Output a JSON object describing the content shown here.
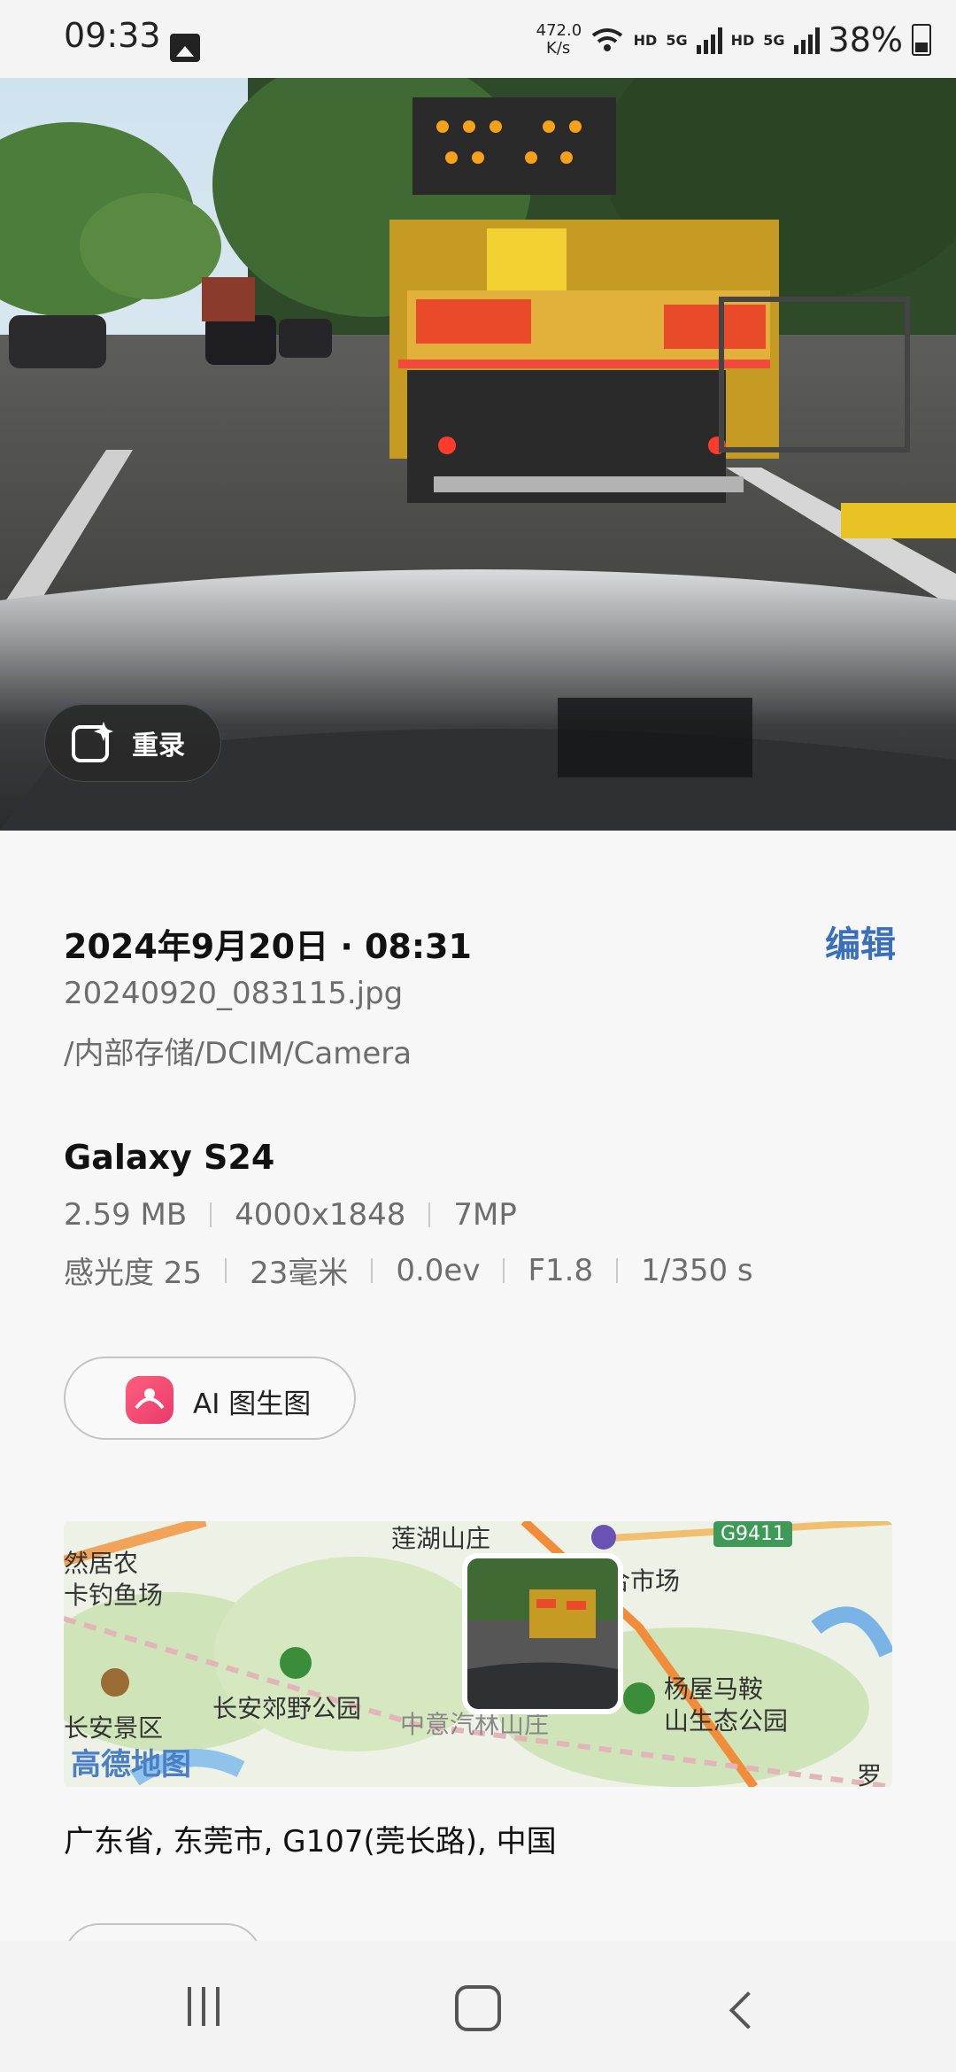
{
  "status_bar": {
    "time": "09:33",
    "net_speed_value": "472.0",
    "net_speed_unit": "K/s",
    "hd1": "HD",
    "g1": "5G",
    "hd2": "HD",
    "g2": "5G",
    "battery": "38%"
  },
  "photo": {
    "remaster_label": "重录"
  },
  "details": {
    "date": "2024年9月20日 · 08:31",
    "edit_label": "编辑",
    "filename": "20240920_083115.jpg",
    "path": "/内部存储/DCIM/Camera",
    "device": "Galaxy S24",
    "size": "2.59 MB",
    "resolution": "4000x1848",
    "megapixels": "7MP",
    "iso": "感光度 25",
    "focal": "23毫米",
    "ev": "0.0ev",
    "aperture": "F1.8",
    "shutter": "1/350 s",
    "ai_button_label": "AI 图生图"
  },
  "map": {
    "labels": {
      "lianhu": "莲湖山庄",
      "ranju": "然居农",
      "diaoyu": "卡钓鱼场",
      "market": "屋综合市场",
      "changan_park": "长安郊野公园",
      "yangwu": "杨屋马鞍",
      "ecopark": "山生态公园",
      "changan_area": "长安景区",
      "hidden": "中意汽林山庄",
      "luo": "罗",
      "road": "G9411"
    },
    "logo": "高德地图"
  },
  "location": {
    "address": "广东省, 东莞市, G107(莞长路), 中国"
  }
}
